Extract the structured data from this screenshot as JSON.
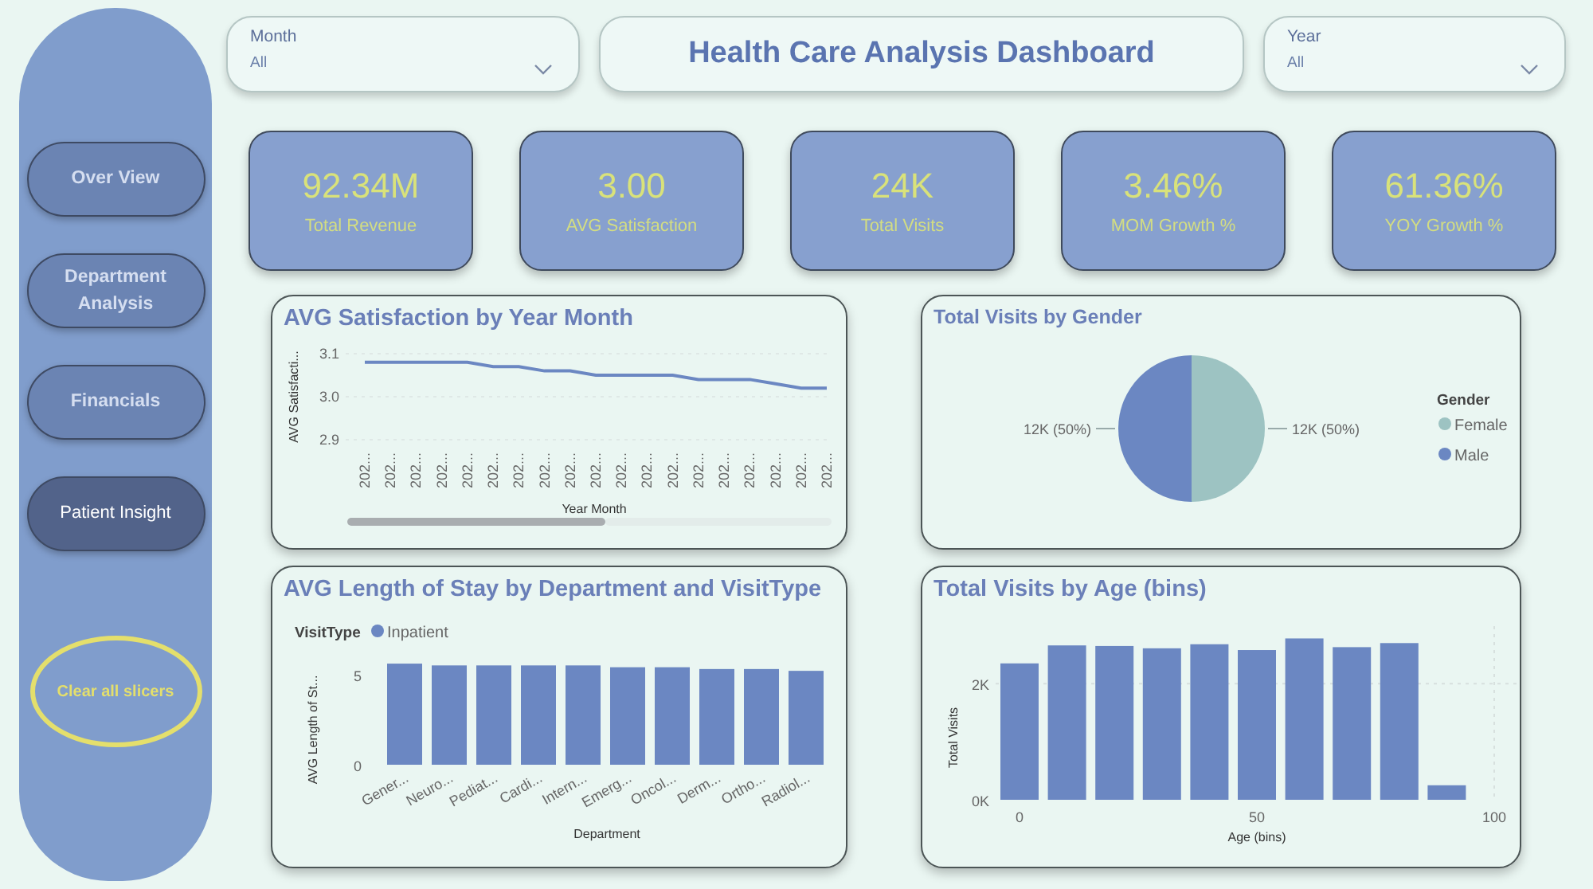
{
  "sidebar": {
    "nav_buttons": [
      {
        "label": "Over View",
        "selected": false
      },
      {
        "label": "Department Analysis",
        "selected": false
      },
      {
        "label": "Financials",
        "selected": false
      },
      {
        "label": "Patient Insight",
        "selected": true
      }
    ],
    "clear_button": {
      "label": "Clear all slicers"
    }
  },
  "header": {
    "month_slicer": {
      "label": "Month",
      "value": "All"
    },
    "title": "Health Care Analysis Dashboard",
    "year_slicer": {
      "label": "Year",
      "value": "All"
    }
  },
  "kpis": [
    {
      "value": "92.34M",
      "label": "Total Revenue"
    },
    {
      "value": "3.00",
      "label": "AVG Satisfaction"
    },
    {
      "value": "24K",
      "label": "Total Visits"
    },
    {
      "value": "3.46%",
      "label": "MOM Growth %"
    },
    {
      "value": "61.36%",
      "label": "YOY Growth %"
    }
  ],
  "charts": [
    {
      "chart_data": {
        "type": "line",
        "title": "AVG Satisfaction by Year Month",
        "xlabel": "Year Month",
        "ylabel": "AVG Satisfacti...",
        "categories": [
          "202...",
          "202...",
          "202...",
          "202...",
          "202...",
          "202...",
          "202...",
          "202...",
          "202...",
          "202...",
          "202...",
          "202...",
          "202...",
          "202...",
          "202...",
          "202...",
          "202...",
          "202...",
          "202..."
        ],
        "series": [
          {
            "color": "#6b87c2",
            "values": [
              3.08,
              3.08,
              3.08,
              3.08,
              3.08,
              3.07,
              3.07,
              3.06,
              3.06,
              3.05,
              3.05,
              3.05,
              3.05,
              3.04,
              3.04,
              3.04,
              3.03,
              3.02,
              3.02
            ]
          }
        ],
        "ylim": [
          2.9,
          3.1
        ],
        "yticks": [
          {
            "value": 2.9,
            "label": "2.9"
          },
          {
            "value": 3.0,
            "label": "3.0"
          },
          {
            "value": 3.1,
            "label": "3.1"
          }
        ]
      }
    },
    {
      "chart_data": {
        "type": "pie",
        "title": "Total Visits by Gender",
        "legend": {
          "title": "Gender"
        },
        "categories": [
          "Female",
          "Male"
        ],
        "values": [
          12000,
          12000
        ],
        "colors": [
          "#9dc3c2",
          "#6b87c2"
        ],
        "value_labels": [
          "12K (50%)",
          "12K (50%)"
        ]
      }
    },
    {
      "chart_data": {
        "type": "bar",
        "title": "AVG Length of Stay by Department and VisitType",
        "xlabel": "Department",
        "ylabel": "AVG Length of St...",
        "legend": {
          "title": "VisitType"
        },
        "categories": [
          "Gener...",
          "Neuro...",
          "Pediat...",
          "Cardi...",
          "Intern...",
          "Emerg...",
          "Oncol...",
          "Derm...",
          "Ortho...",
          "Radiol..."
        ],
        "series": [
          {
            "name": "Inpatient",
            "color": "#6b87c2",
            "values": [
              5.6,
              5.5,
              5.5,
              5.5,
              5.5,
              5.4,
              5.4,
              5.3,
              5.3,
              5.2
            ]
          }
        ],
        "ylim": [
          0,
          6
        ],
        "yticks": [
          0,
          5
        ]
      }
    },
    {
      "chart_data": {
        "type": "bar",
        "title": "Total Visits by Age (bins)",
        "xlabel": "Age (bins)",
        "ylabel": "Total Visits",
        "x": [
          0,
          10,
          20,
          30,
          40,
          50,
          60,
          70,
          80,
          90
        ],
        "series": [
          {
            "color": "#6b87c2",
            "values": [
              2350,
              2660,
              2650,
              2610,
              2680,
              2580,
              2780,
              2630,
              2700,
              250
            ]
          }
        ],
        "xlim": [
          0,
          100
        ],
        "ylim": [
          0,
          2800
        ],
        "xticks": [
          0,
          50,
          100
        ],
        "yticks": [
          {
            "value": 0,
            "label": "0K"
          },
          {
            "value": 2000,
            "label": "2K"
          }
        ]
      }
    }
  ]
}
